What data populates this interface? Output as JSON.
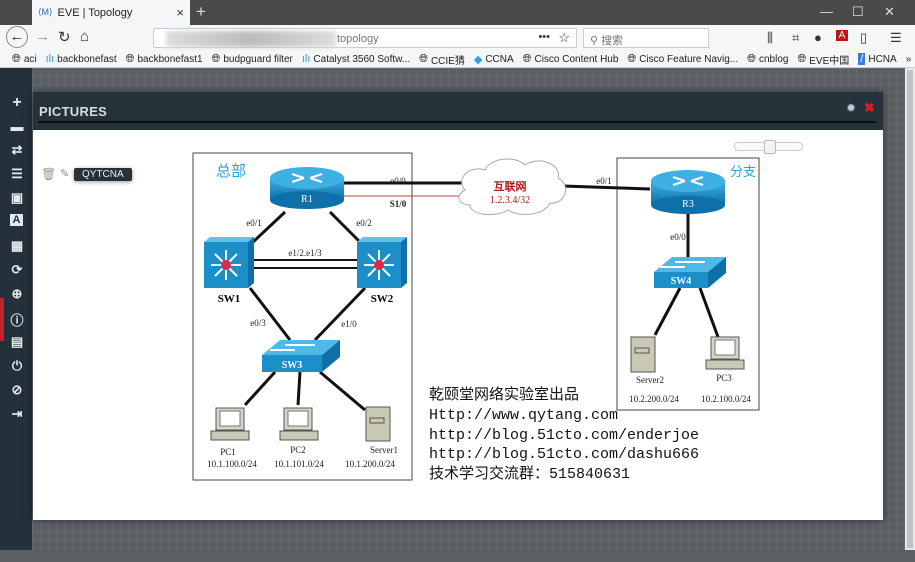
{
  "browser": {
    "tab_title": "EVE | Topology",
    "tab_close": "×",
    "new_tab": "+",
    "url_visible": "topology",
    "search_placeholder": "搜索",
    "bookmarks": [
      "aci",
      "backbonefast",
      "backbonefast1",
      "budpguard filter",
      "Catalyst 3560 Softw...",
      "CCIE猜",
      "CCNA",
      "Cisco Content Hub",
      "Cisco Feature Navig...",
      "cnblog",
      "EVE中国",
      "HCNA"
    ],
    "bookmarks_overflow": "»"
  },
  "sidebar": {
    "items": [
      "add-icon",
      "storage-icon",
      "networks-icon",
      "startup-configs-icon",
      "pictures-icon",
      "text-icon",
      "grid-icon",
      "refresh-icon",
      "zoom-icon",
      "info-icon",
      "notes-icon",
      "power-icon",
      "lock-icon",
      "logout-icon"
    ]
  },
  "modal": {
    "title": "PICTURES",
    "picture_name": "QYTCNA",
    "zoom_slider": 0.5
  },
  "diagram": {
    "hq_label": "总部",
    "branch_label": "分支",
    "internet_label": "互联网",
    "internet_ip": "1.2.3.4/32",
    "devices": {
      "r1": "R1",
      "r3": "R3",
      "sw1": "SW1",
      "sw2": "SW2",
      "sw3": "SW3",
      "sw4": "SW4",
      "pc1": "PC1",
      "pc2": "PC2",
      "pc3": "PC3",
      "server1": "Server1",
      "server2": "Server2"
    },
    "links": {
      "r1_e00": "e0/0",
      "r1_s10": "S1/0",
      "r3_e01": "e0/1",
      "r1_e01": "e0/1",
      "r1_e02": "e0/2",
      "sw_trunk": "e1/2.e1/3",
      "sw1_e03": "e0/3",
      "sw2_e10": "e1/0",
      "r3_e00": "e0/0"
    },
    "subnets": {
      "pc1": "10.1.100.0/24",
      "pc2": "10.1.101.0/24",
      "server1": "10.1.200.0/24",
      "server2": "10.2.200.0/24",
      "pc3": "10.2.100.0/24"
    },
    "credits": [
      "乾颐堂网络实验室出品",
      "Http://www.qytang.com",
      "http://blog.51cto.com/enderjoe",
      "http://blog.51cto.com/dashu666",
      "技术学习交流群：515840631"
    ],
    "colors": {
      "hq_label": "#2aa3dc",
      "internet": "#b01818",
      "device": "#1c8fc8"
    }
  }
}
